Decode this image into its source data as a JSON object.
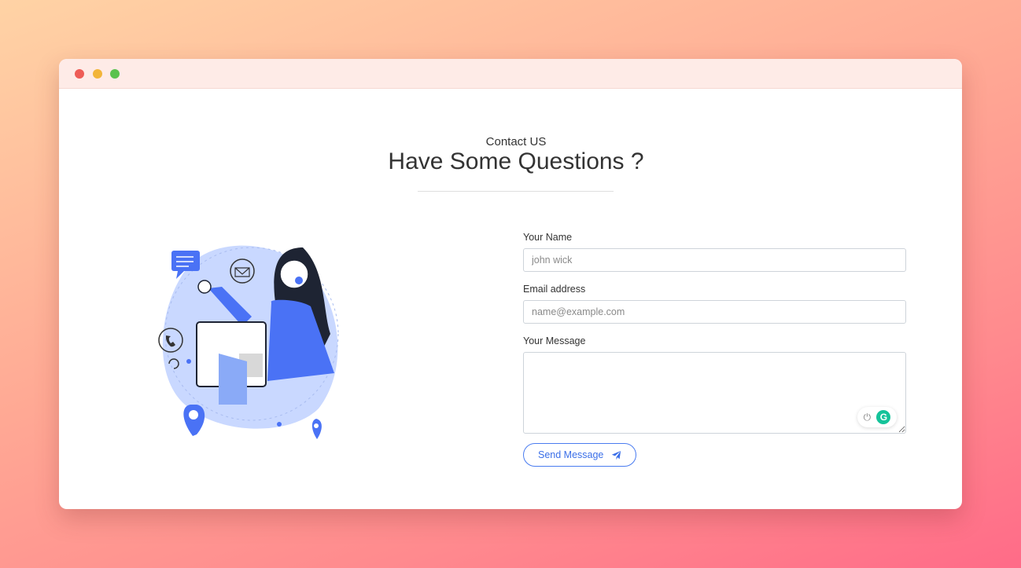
{
  "header": {
    "eyebrow": "Contact US",
    "title_light": "Have Some ",
    "title_bold": "Questions ?"
  },
  "form": {
    "name_label": "Your Name",
    "name_placeholder": "john wick",
    "email_label": "Email address",
    "email_placeholder": "name@example.com",
    "message_label": "Your Message",
    "message_value": "",
    "send_label": "Send Message"
  },
  "icons": {
    "send": "paper-plane-icon",
    "grammarly": "grammarly-icon",
    "power": "power-icon"
  },
  "colors": {
    "accent": "#3b6fe8",
    "illustration_blob": "#c9d8ff",
    "grammarly": "#15c39a"
  }
}
